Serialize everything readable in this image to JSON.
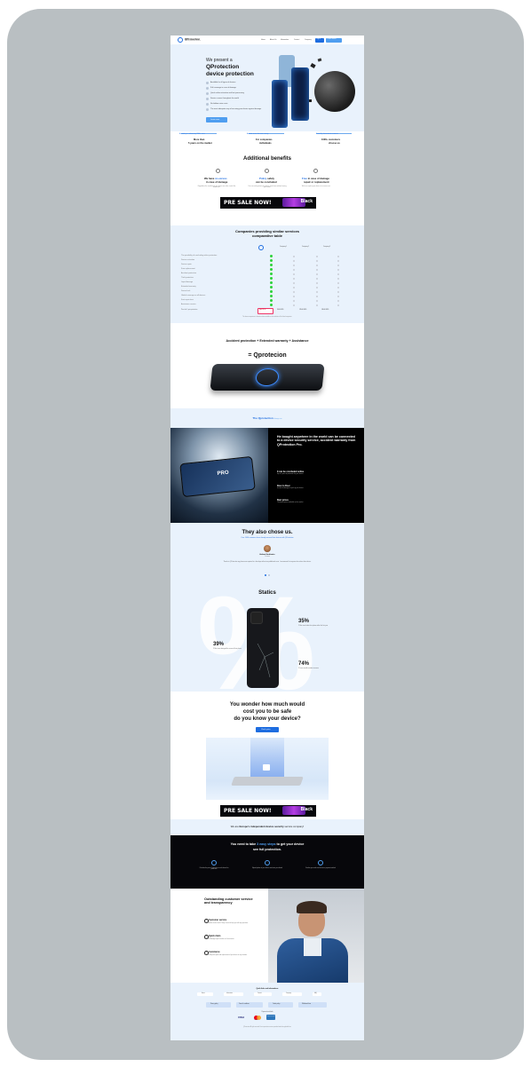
{
  "nav": {
    "brand": "QProtection",
    "brand_sub": "Device protection service",
    "links": [
      "Home",
      "About Us",
      "Information",
      "Contact",
      "Company"
    ],
    "login": "Log in",
    "cta": "Protect device"
  },
  "hero": {
    "pre": "We present a",
    "title1": "QProtection",
    "title2": "device protection",
    "features": [
      "Available for all types of devices",
      "Full coverage in case of damage",
      "Quick online activation and fast processing",
      "Service covers throughout the world",
      "No hidden extra costs",
      "The most adequate way of securing your device against damage"
    ],
    "button": "Learn more"
  },
  "stats_strip": [
    {
      "top": "Availability is confirmed by 12000+ users",
      "main1": "More than",
      "main2": "5 years on the market"
    },
    {
      "top": "Available across the entire country",
      "main1": "For companies",
      "main2": "individuals"
    },
    {
      "top": "Trusted by thousands of customers",
      "main1": "1000+ customers",
      "main2": "choose us"
    }
  ],
  "benefits": {
    "title": "Additional benefits",
    "items": [
      {
        "h_pre": "We have ",
        "h_hl": "no excess",
        "h2": "in case of damage",
        "p": "Regardless the condition of your device we make it work like brand new."
      },
      {
        "h_pre": "",
        "h_hl": "Policy",
        "h_post": " safely",
        "h2": "can be concluded",
        "p": "You can easily protect your device from home without leaving your home."
      },
      {
        "h_pre": "",
        "h_hl": "Free",
        "h_post": " in case of damage",
        "h2": "repair or replacement",
        "p": "We fix or replace your device at no extra cost."
      }
    ]
  },
  "banner": {
    "text": "PRE SALE NOW!",
    "badge": "Black"
  },
  "comparison": {
    "title1": "Companies providing similar services",
    "title2": "comparative table",
    "columns": [
      "QProtection",
      "Company 1",
      "Company 2",
      "Company 3"
    ],
    "rows": [
      "The possibility of concluding online protection",
      "Device activation",
      "Device repair",
      "Free replacement",
      "Accident protection",
      "Theft protection",
      "Liquid damage",
      "Extended warranty",
      "Device lock",
      "Global coverage on all devices",
      "Fast repair time",
      "Assistance service"
    ],
    "price_label": "Price for 1 year protection",
    "prices": [
      "from 99.00",
      "99.00 USD",
      "129.00 USD",
      "149.00 USD"
    ],
    "note": "The above comparison is based on data available on the websites of the listed companies."
  },
  "formula": {
    "line1": "Accident protection + Extended warranty + Assistance",
    "line2": "= Qprotecion"
  },
  "pro_bar": {
    "label": "The Qprotection",
    "sub": "always on"
  },
  "pro": {
    "title": "He bought anywhere in the world can be connected to a device security service, accident warranty from QProtection Pro.",
    "items": [
      {
        "h": "It can be concluded online",
        "p": "Up to 2 years of protection for your device"
      },
      {
        "h": "Door to Door",
        "p": "In case of damage we pick up your device"
      },
      {
        "h": "Best prices",
        "p": "The lowest prices available on the market"
      }
    ],
    "image_text": "PRO"
  },
  "testimonials": {
    "title": "They also chose us.",
    "subtitle": "Over 1000 customers have already secured their devices with QProtection",
    "name": "Andrew Sienkiewicz",
    "role": "Customer",
    "quote": "Thanks to QProtection my phone was repaired in a few days without any additional costs. I recommend it to anyone who values their device."
  },
  "statics": {
    "title": "Statics",
    "items": [
      {
        "value": "35%",
        "text": "Of the users broke their phone within the first year"
      },
      {
        "value": "39%",
        "text": "Of the users damaged the screen of their phone"
      },
      {
        "value": "74%",
        "text": "Of users would consider insurance"
      }
    ]
  },
  "wonder": {
    "title1": "You wonder how much would",
    "title2": "cost you to be safe",
    "title3": "do you know your device?",
    "button": "Check price"
  },
  "europe": {
    "pre": "We are ",
    "bold": "Europe's independent device security",
    "post": " service company!"
  },
  "steps": {
    "title_pre": "You need to take ",
    "title_hl": "3 easy steps",
    "title_post": " to get your device",
    "title2": "see full protection.",
    "items": [
      "Calculate the price of your device and choose the protection",
      "Upload photos of your device and enter your details",
      "Finalize your order and receive a payment method"
    ]
  },
  "service": {
    "title": "Outstanding customer service and transparency",
    "items": [
      {
        "h": "Customer service",
        "p": "Our customer service works 7 days a week to help you with any questions."
      },
      {
        "h": "Quick claim",
        "p": "In case of damage report it online in a few minutes."
      },
      {
        "h": "Assistance",
        "p": "We offer help with repair and replacement of your device in any situation."
      }
    ]
  },
  "footer": {
    "links_title": "Quick links and informations",
    "links": [
      "Home",
      "Information",
      "Contact",
      "Company",
      "FAQ"
    ],
    "docs": [
      "Privacy policy",
      "Terms & conditions",
      "Cookie policy",
      "Withdrawal form"
    ],
    "payments_title": "Payment methods",
    "payments": [
      "VISA",
      "mastercard",
      "AMERICAN EXPRESS"
    ],
    "legal": "QProtection. All rights reserved. Device protection services provided under the applicable law."
  },
  "colors": {
    "accent": "#1e6de0",
    "light_bg": "#e8f1fb",
    "dark": "#0a0a0e",
    "green": "#2dd23a"
  }
}
